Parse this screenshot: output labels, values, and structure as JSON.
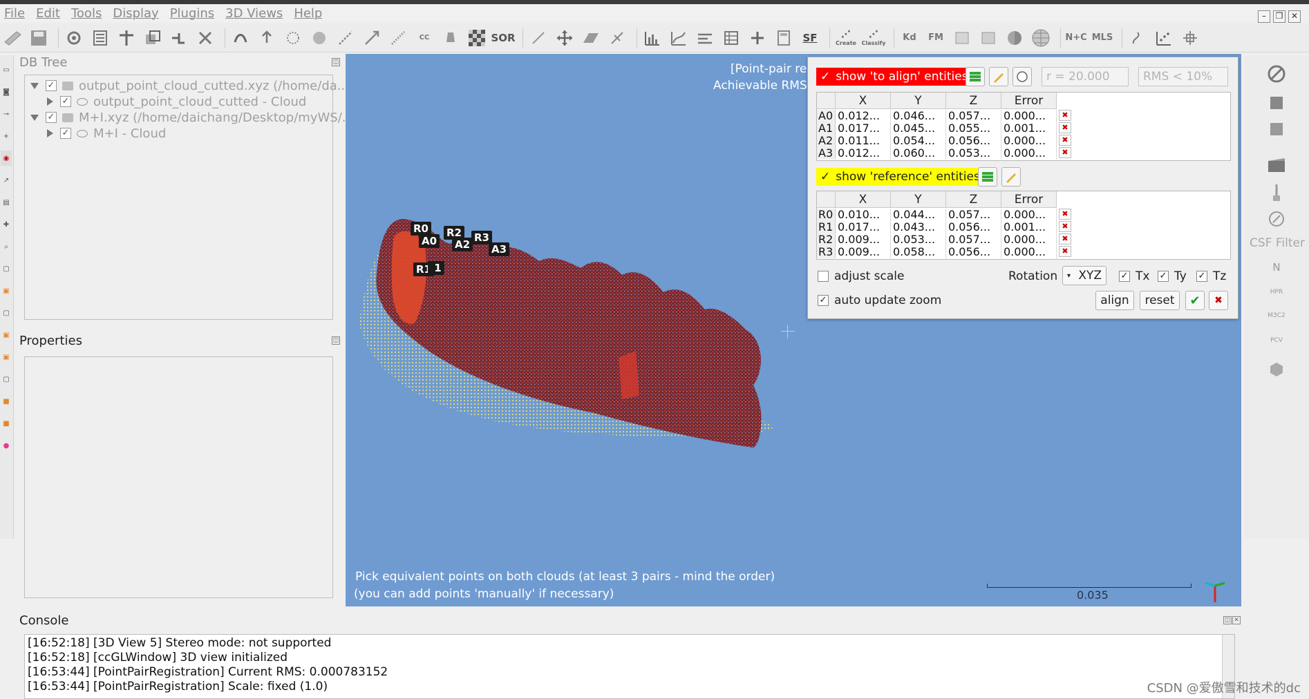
{
  "menu": [
    "File",
    "Edit",
    "Tools",
    "Display",
    "Plugins",
    "3D Views",
    "Help"
  ],
  "toolbar": {
    "sor_label": "SOR",
    "sf_label": "SF",
    "kd_label": "Kd",
    "fm_label": "FM",
    "nc_label": "N+C",
    "mls_label": "MLS",
    "canupo_create": "Create",
    "canupo_classify": "Classify"
  },
  "db_tree": {
    "title": "DB Tree",
    "items": [
      {
        "label": "output_point_cloud_cutted.xyz (/home/da...",
        "level": 0,
        "expanded": true
      },
      {
        "label": "output_point_cloud_cutted - Cloud",
        "level": 1,
        "expanded": false
      },
      {
        "label": "M+I.xyz (/home/daichang/Desktop/myWS/...",
        "level": 0,
        "expanded": true
      },
      {
        "label": "M+I - Cloud",
        "level": 1,
        "expanded": false
      }
    ]
  },
  "properties": {
    "title": "Properties"
  },
  "view3d": {
    "overlay_line1": "[Point-pair reg",
    "overlay_line2": "Achievable RMS: (",
    "message_line1": "Pick equivalent points on both clouds (at least 3 pairs - mind the order)",
    "message_line2": "(you can add points 'manually' if necessary)",
    "scale_value": "0.035",
    "labels": [
      "R0",
      "A0",
      "R2",
      "A2",
      "R3",
      "A3",
      "R1",
      " 1"
    ],
    "colors": {
      "background": "#6f9bd1",
      "cloud_red": "#c0392b",
      "cloud_yellow": "#f1e56a"
    }
  },
  "registration": {
    "show_to_align_label": "show 'to align' entities",
    "show_reference_label": "show 'reference' entities",
    "radius_placeholder": "r = 20.000",
    "rms_placeholder": "RMS < 10%",
    "columns": [
      "X",
      "Y",
      "Z",
      "Error"
    ],
    "align_rows": [
      {
        "id": "A0",
        "x": "0.012...",
        "y": "0.046...",
        "z": "0.057...",
        "err": "0.000..."
      },
      {
        "id": "A1",
        "x": "0.017...",
        "y": "0.045...",
        "z": "0.055...",
        "err": "0.001..."
      },
      {
        "id": "A2",
        "x": "0.011...",
        "y": "0.054...",
        "z": "0.056...",
        "err": "0.000..."
      },
      {
        "id": "A3",
        "x": "0.012...",
        "y": "0.060...",
        "z": "0.053...",
        "err": "0.000..."
      }
    ],
    "reference_rows": [
      {
        "id": "R0",
        "x": "0.010...",
        "y": "0.044...",
        "z": "0.057...",
        "err": "0.000..."
      },
      {
        "id": "R1",
        "x": "0.017...",
        "y": "0.043...",
        "z": "0.056...",
        "err": "0.001..."
      },
      {
        "id": "R2",
        "x": "0.009...",
        "y": "0.053...",
        "z": "0.057...",
        "err": "0.000..."
      },
      {
        "id": "R3",
        "x": "0.009...",
        "y": "0.058...",
        "z": "0.056...",
        "err": "0.000..."
      }
    ],
    "adjust_scale_label": "adjust scale",
    "rotation_label": "Rotation",
    "rotation_value": "XYZ",
    "tx_label": "Tx",
    "ty_label": "Ty",
    "tz_label": "Tz",
    "auto_update_zoom_label": "auto update zoom",
    "align_button": "align",
    "reset_button": "reset",
    "checks": {
      "show_to_align": true,
      "show_reference": true,
      "adjust_scale": false,
      "tx": true,
      "ty": true,
      "tz": true,
      "auto_update_zoom": true
    }
  },
  "right_tools": {
    "csf_label": "CSF Filter",
    "n_label": "N",
    "hpr_label": "HPR",
    "m3c2_label": "M3C2",
    "pcv_label": "PCV"
  },
  "console": {
    "title": "Console",
    "lines": [
      "[16:52:18] [3D View 5] Stereo mode: not supported",
      "[16:52:18] [ccGLWindow] 3D view initialized",
      "[16:53:44] [PointPairRegistration] Current RMS: 0.000783152",
      "[16:53:44] [PointPairRegistration] Scale: fixed (1.0)"
    ]
  },
  "watermark": "CSDN @爱傲雪和技术的dc"
}
